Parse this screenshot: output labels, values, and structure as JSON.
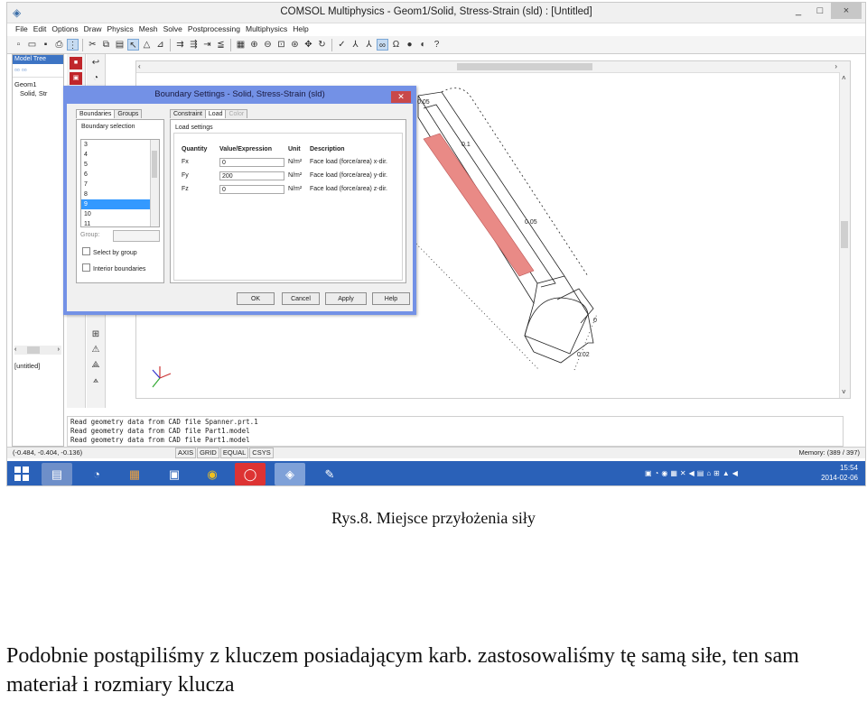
{
  "window": {
    "title": "COMSOL Multiphysics - Geom1/Solid, Stress-Strain (sld) : [Untitled]",
    "controls": [
      "_",
      "□",
      "×"
    ]
  },
  "menu": [
    "File",
    "Edit",
    "Options",
    "Draw",
    "Physics",
    "Mesh",
    "Solve",
    "Postprocessing",
    "Multiphysics",
    "Help"
  ],
  "model_tree": {
    "header": "Model Tree",
    "items": [
      "Geom1",
      "Solid, Str"
    ],
    "untitled": "[untitled]"
  },
  "canvas": {
    "axis_labels": [
      "0.05",
      "0.1",
      "0.05",
      "0",
      "0.02"
    ],
    "highlight_color": "#e98a86"
  },
  "dialog": {
    "title": "Boundary Settings - Solid, Stress-Strain (sld)",
    "left_tabs": [
      "Boundaries",
      "Groups"
    ],
    "right_tabs": [
      "Constraint",
      "Load",
      "Color"
    ],
    "boundary_selection_label": "Boundary selection",
    "boundaries": [
      "3",
      "4",
      "5",
      "6",
      "7",
      "8",
      "9",
      "10",
      "11"
    ],
    "selected_boundary": "9",
    "group_label": "Group:",
    "select_by_group": "Select by group",
    "interior_boundaries": "Interior boundaries",
    "load_settings_label": "Load settings",
    "columns": [
      "Quantity",
      "Value/Expression",
      "Unit",
      "Description"
    ],
    "rows": [
      {
        "q": "Fx",
        "value": "0",
        "unit": "N/m²",
        "desc": "Face load (force/area) x-dir."
      },
      {
        "q": "Fy",
        "value": "200",
        "unit": "N/m²",
        "desc": "Face load (force/area) y-dir."
      },
      {
        "q": "Fz",
        "value": "0",
        "unit": "N/m²",
        "desc": "Face load (force/area) z-dir."
      }
    ],
    "buttons": [
      "OK",
      "Cancel",
      "Apply",
      "Help"
    ]
  },
  "log": [
    "Read geometry data from CAD file Spanner.prt.1",
    "Read geometry data from CAD file Part1.model",
    "Read geometry data from CAD file Part1.model"
  ],
  "status": {
    "coords": "(-0.484, -0.404, -0.136)",
    "toggles": [
      "AXIS",
      "GRID",
      "EQUAL",
      "CSYS"
    ],
    "memory": "Memory: (389 / 397)"
  },
  "taskbar": {
    "time": "15:54",
    "date": "2014-02-06"
  },
  "caption": "Rys.8. Miejsce przyłożenia siły",
  "paragraph": "Podobnie postąpiliśmy z kluczem posiadającym karb. zastosowaliśmy tę samą siłe, ten sam materiał i rozmiary klucza"
}
